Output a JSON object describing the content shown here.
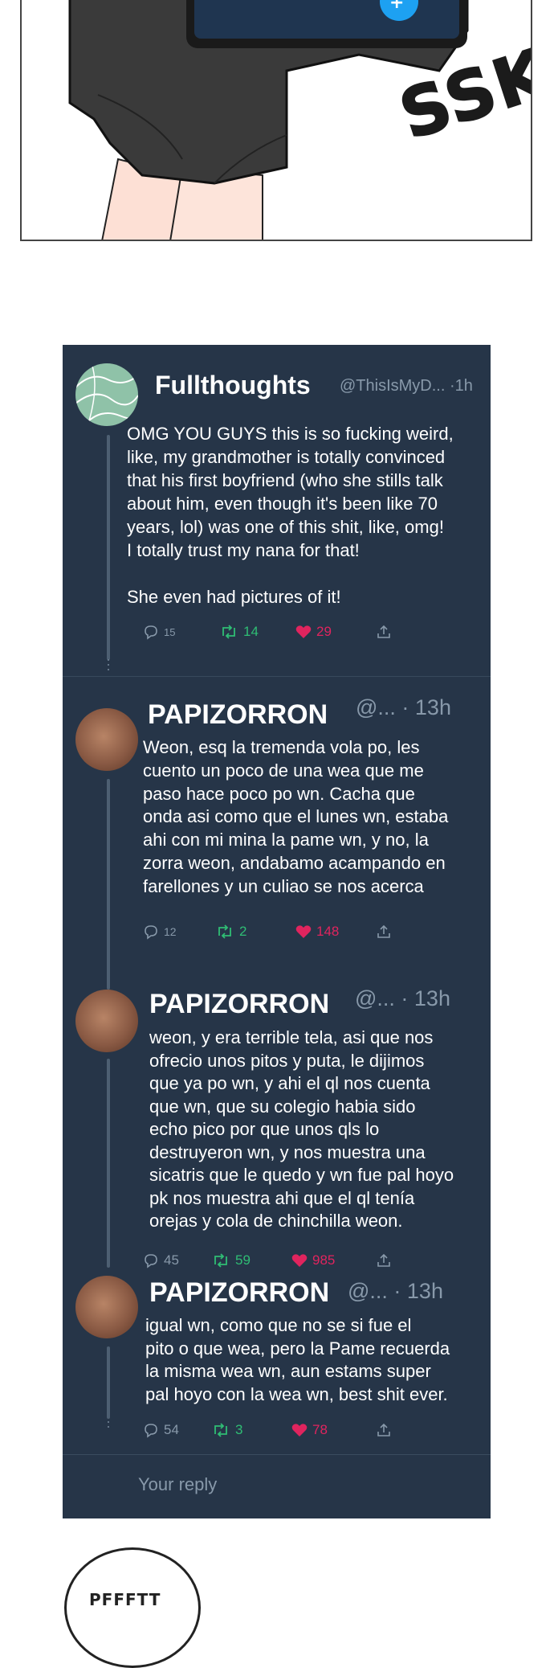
{
  "comic_top": {
    "sfx": "SSK"
  },
  "tweets": [
    {
      "name": "Fullthoughts",
      "handle": "@ThisIsMyD... ·1h",
      "text": "OMG YOU GUYS this is so fucking weird,\nlike, my grandmother is totally convinced\nthat his first boyfriend (who she stills talk\nabout him, even though it's been like 70\n years, lol) was one of this shit, like, omg!\n I totally trust my nana for that!\n\nShe even had pictures of it!",
      "replies": "15",
      "retweets": "14",
      "likes": "29"
    },
    {
      "name": "PAPIZORRON",
      "handle": "@... · 13h",
      "text": "Weon, esq la tremenda vola po, les\ncuento un poco de una wea que me\npaso hace poco po wn. Cacha que\nonda asi como que el lunes wn, estaba\nahi con mi mina la pame wn, y no, la\nzorra weon, andabamo acampando en\nfarellones y un culiao se nos acerca",
      "replies": "12",
      "retweets": "2",
      "likes": "148"
    },
    {
      "name": "PAPIZORRON",
      "handle": "@... · 13h",
      "text": "weon, y era terrible tela, asi que nos\nofrecio unos pitos y puta, le dijimos\nque ya po wn, y ahi el ql nos cuenta\nque wn, que su colegio habia sido\necho pico por que unos qls lo\ndestruyeron wn, y nos muestra una\nsicatris que le quedo y wn fue pal hoyo\npk nos muestra ahi que el ql tenía\norejas y cola de chinchilla weon.",
      "replies": "45",
      "retweets": "59",
      "likes": "985"
    },
    {
      "name": "PAPIZORRON",
      "handle": "@... · 13h",
      "text": "igual wn, como que no se si fue el\npito o que wea, pero la Pame recuerda\nla misma wea wn, aun estams super\npal hoyo con la wea wn, best shit ever.",
      "replies": "54",
      "retweets": "3",
      "likes": "78"
    }
  ],
  "reply_box": {
    "placeholder": "Your reply"
  },
  "comic_bottom": {
    "bubble_text": "PFFFTT"
  }
}
